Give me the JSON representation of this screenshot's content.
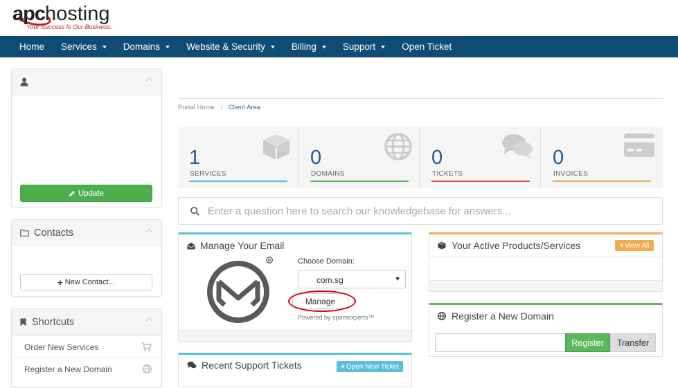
{
  "brand": {
    "name_a": "apc",
    "name_b": "hosting",
    "tagline": "Your Success Is Our Business."
  },
  "nav": {
    "items": [
      {
        "label": "Home",
        "dropdown": false
      },
      {
        "label": "Services",
        "dropdown": true
      },
      {
        "label": "Domains",
        "dropdown": true
      },
      {
        "label": "Website & Security",
        "dropdown": true
      },
      {
        "label": "Billing",
        "dropdown": true
      },
      {
        "label": "Support",
        "dropdown": true
      },
      {
        "label": "Open Ticket",
        "dropdown": false
      }
    ]
  },
  "sidebar": {
    "profile": {
      "update_label": "Update"
    },
    "contacts": {
      "title": "Contacts",
      "new_contact_label": "New Contact..."
    },
    "shortcuts": {
      "title": "Shortcuts",
      "items": [
        {
          "label": "Order New Services",
          "icon": "cart-icon"
        },
        {
          "label": "Register a New Domain",
          "icon": "globe-icon"
        }
      ]
    }
  },
  "breadcrumb": {
    "home": "Portal Home",
    "separator": "/",
    "current": "Client Area"
  },
  "stats": [
    {
      "value": "1",
      "label": "SERVICES",
      "color": "#5bc0de",
      "icon": "cube-icon"
    },
    {
      "value": "0",
      "label": "DOMAINS",
      "color": "#5cb85c",
      "icon": "globe-icon"
    },
    {
      "value": "0",
      "label": "TICKETS",
      "color": "#d9534f",
      "icon": "comments-icon"
    },
    {
      "value": "0",
      "label": "INVOICES",
      "color": "#f0ad4e",
      "icon": "credit-card-icon"
    }
  ],
  "kb_search": {
    "placeholder": "Enter a question here to search our knowledgebase for answers..."
  },
  "email_panel": {
    "title": "Manage Your Email",
    "choose_label": "Choose Domain:",
    "selected_domain": "com.sg",
    "manage_label": "Manage",
    "powered_by": "Powered by spamexperts™",
    "accent": "#5bc0de"
  },
  "products_panel": {
    "title": "Your Active Products/Services",
    "view_all_label": "View All",
    "accent": "#f0ad4e"
  },
  "register_panel": {
    "title": "Register a New Domain",
    "register_label": "Register",
    "transfer_label": "Transfer",
    "accent": "#5cb85c"
  },
  "tickets_panel": {
    "title": "Recent Support Tickets",
    "open_new_label": "Open New Ticket",
    "accent": "#5bc0de"
  },
  "colors": {
    "nav_bg": "#0f4c75",
    "link": "#1f6fa3",
    "green": "#5cb85c",
    "annotation_red": "#d0021b"
  }
}
